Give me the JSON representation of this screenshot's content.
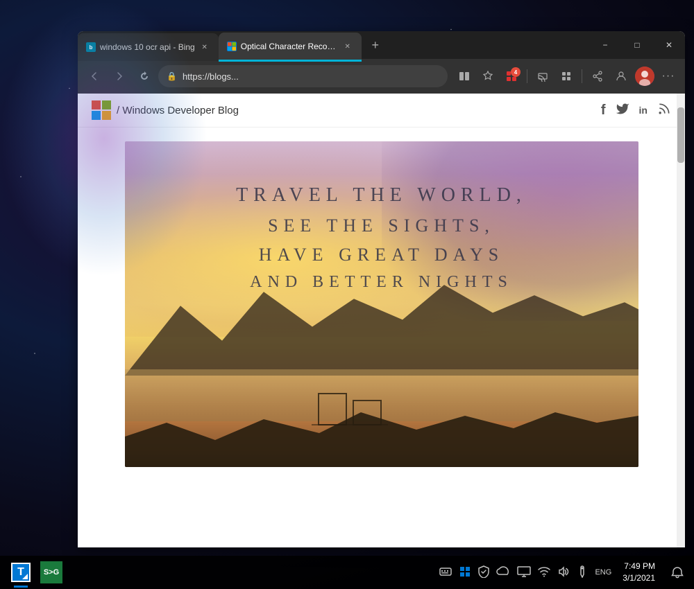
{
  "desktop": {
    "background": "space nebula"
  },
  "browser": {
    "tabs": [
      {
        "id": "tab-bing",
        "label": "windows 10 ocr api - Bing",
        "favicon_type": "bing",
        "favicon_letter": "b",
        "active": false
      },
      {
        "id": "tab-ocr",
        "label": "Optical Character Recognition (O...",
        "favicon_type": "ms",
        "favicon_letter": "e",
        "active": true
      }
    ],
    "new_tab_label": "+",
    "window_controls": {
      "minimize": "−",
      "maximize": "□",
      "close": "✕"
    },
    "navbar": {
      "back_arrow": "←",
      "forward_arrow": "→",
      "refresh": "↻",
      "address": "https://blogs...",
      "lock_icon": "🔒"
    },
    "tools": {
      "reader_icon": "⊡",
      "favorites_icon": "☆",
      "collections_badge": "4",
      "cast_icon": "⊡",
      "tab_manager": "⊞",
      "share_icon": "↗",
      "profile_icon": "⚙",
      "more_icon": "..."
    }
  },
  "webpage": {
    "logo_text": "/ Windows Developer Blog",
    "social_icons": {
      "facebook": "f",
      "twitter": "🐦",
      "linkedin": "in",
      "rss": "◉"
    },
    "article_image": {
      "line1": "Travel the World,",
      "line2": "See the Sights,",
      "line3": "Have Great Days",
      "line4": "And Better Nights"
    }
  },
  "taskbar": {
    "items": [
      {
        "id": "t-icon",
        "label": "T",
        "active": true
      },
      {
        "id": "sg-icon",
        "label": "S>G",
        "active": false
      }
    ],
    "system_icons": {
      "network": "📶",
      "volume": "🔊",
      "battery": "🔋",
      "wifi": "📡",
      "language": "ENG"
    },
    "clock": {
      "time": "7:49 PM",
      "date": "3/1/2021"
    },
    "notification_icon": "🔔"
  }
}
